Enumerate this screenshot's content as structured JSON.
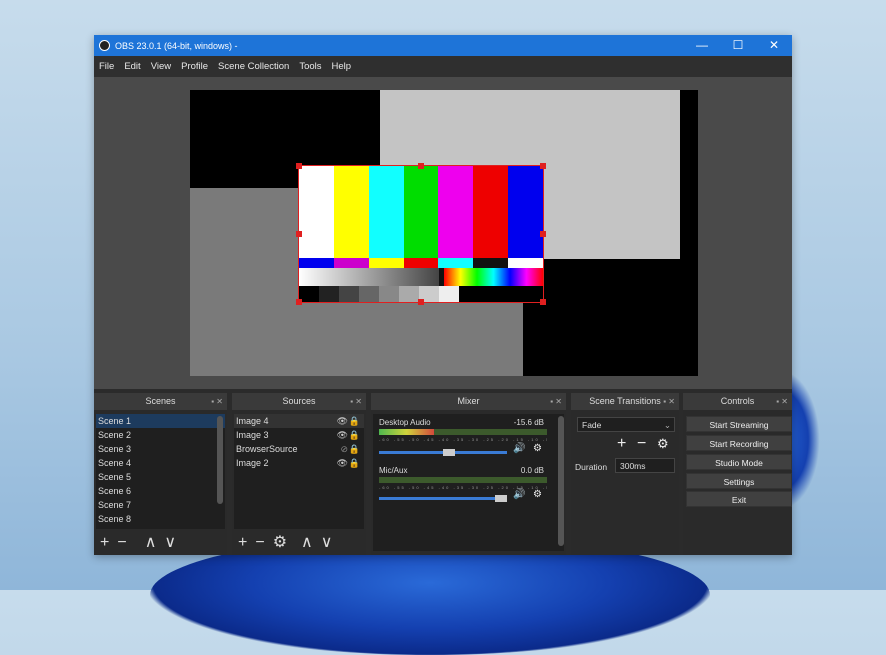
{
  "window": {
    "title": "OBS 23.0.1 (64-bit, windows) -",
    "minimize": "—",
    "maximize": "☐",
    "close": "✕"
  },
  "menu": [
    "File",
    "Edit",
    "View",
    "Profile",
    "Scene Collection",
    "Tools",
    "Help"
  ],
  "docks": {
    "scenes": {
      "title": "Scenes",
      "items": [
        "Scene 1",
        "Scene 2",
        "Scene 3",
        "Scene 4",
        "Scene 5",
        "Scene 6",
        "Scene 7",
        "Scene 8"
      ],
      "selected": 0
    },
    "sources": {
      "title": "Sources",
      "items": [
        "Image 4",
        "Image 3",
        "BrowserSource",
        "Image 2"
      ]
    },
    "mixer": {
      "title": "Mixer",
      "channels": [
        {
          "name": "Desktop Audio",
          "db": "-15.6 dB",
          "level": 0.33,
          "volume": 0.55
        },
        {
          "name": "Mic/Aux",
          "db": "0.0 dB",
          "level": 0.0,
          "volume": 0.95
        }
      ],
      "ticks": "-60 -55 -50 -45 -40 -35 -30 -25 -20 -15 -10 -5 0"
    },
    "transitions": {
      "title": "Scene Transitions",
      "selected": "Fade",
      "duration_label": "Duration",
      "duration_value": "300ms"
    },
    "controls": {
      "title": "Controls",
      "buttons": [
        "Start Streaming",
        "Start Recording",
        "Studio Mode",
        "Settings",
        "Exit"
      ]
    }
  },
  "colors": {
    "titlebar": "#1e74d8",
    "panel": "#2b2b2b",
    "selection_outline": "#e02020"
  }
}
